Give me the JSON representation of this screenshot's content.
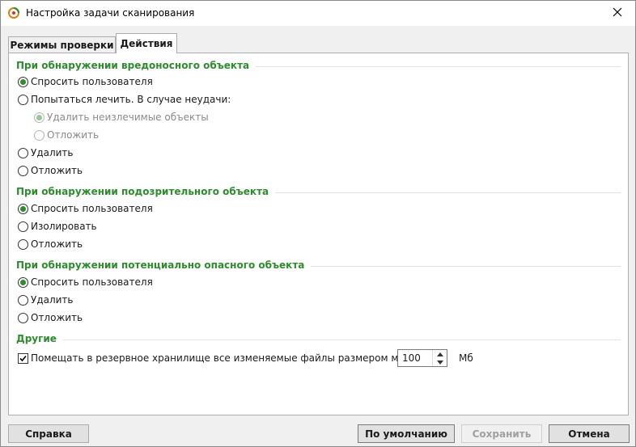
{
  "window": {
    "title": "Настройка задачи сканирования",
    "accent_color": "#2e8b2e"
  },
  "tabs": [
    {
      "label": "Режимы проверки",
      "active": false
    },
    {
      "label": "Действия",
      "active": true
    }
  ],
  "sections": {
    "malicious": {
      "title": "При обнаружении вредоносного объекта",
      "options": [
        {
          "label": "Спросить пользователя",
          "checked": true,
          "disabled": false
        },
        {
          "label": "Попытаться лечить. В случае неудачи:",
          "checked": false,
          "disabled": false
        },
        {
          "label": "Удалить неизлечимые объекты",
          "checked": true,
          "disabled": true
        },
        {
          "label": "Отложить",
          "checked": false,
          "disabled": true
        },
        {
          "label": "Удалить",
          "checked": false,
          "disabled": false
        },
        {
          "label": "Отложить",
          "checked": false,
          "disabled": false
        }
      ]
    },
    "suspicious": {
      "title": "При обнаружении подозрительного объекта",
      "options": [
        {
          "label": "Спросить пользователя",
          "checked": true
        },
        {
          "label": "Изолировать",
          "checked": false
        },
        {
          "label": "Отложить",
          "checked": false
        }
      ]
    },
    "potentially_dangerous": {
      "title": "При обнаружении потенциально опасного объекта",
      "options": [
        {
          "label": "Спросить пользователя",
          "checked": true
        },
        {
          "label": "Удалить",
          "checked": false
        },
        {
          "label": "Отложить",
          "checked": false
        }
      ]
    },
    "other": {
      "title": "Другие",
      "backup_checkbox": {
        "label": "Помещать в резервное хранилище все изменяемые файлы размером менее",
        "checked": true
      },
      "size_value": "100",
      "size_unit": "Мб"
    }
  },
  "buttons": {
    "help": "Справка",
    "default": "По умолчанию",
    "save": "Сохранить",
    "cancel": "Отмена"
  }
}
